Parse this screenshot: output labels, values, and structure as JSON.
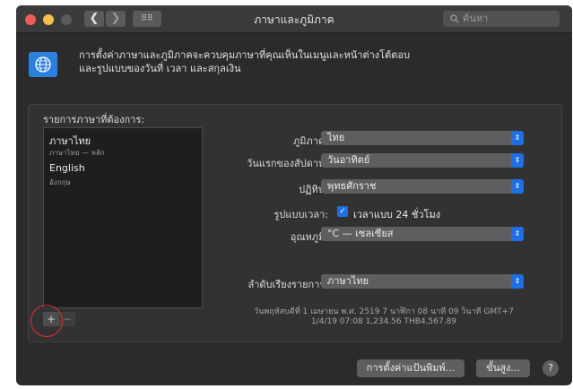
{
  "window": {
    "title": "ภาษาและภูมิภาค",
    "nav": {
      "back": "❮",
      "forward": "❯",
      "grid": "⠿⠿"
    },
    "search_placeholder": "ค้นหา",
    "traffic_lights": {
      "close": "#ec5f57",
      "minimize": "#f4bf4f",
      "zoom": "#5a5a5a"
    }
  },
  "header": {
    "icon": "globe-flag-icon",
    "line1": "การตั้งค่าภาษาและภูมิภาคจะควบคุมภาษาที่คุณเห็นในเมนูและหน้าต่างโต้ตอบ",
    "line2": "และรูปแบบของวันที่ เวลา และสกุลเงิน"
  },
  "preferred_languages": {
    "title": "รายการภาษาที่ต้องการ:",
    "items": [
      {
        "name": "ภาษาไทย",
        "sub": "ภาษาไทย — หลัก"
      },
      {
        "name": "English",
        "sub": "อังกฤษ"
      }
    ],
    "add_label": "+",
    "remove_label": "−"
  },
  "settings": {
    "region": {
      "label": "ภูมิภาค:",
      "value": "ไทย"
    },
    "first_day": {
      "label": "วันแรกของสัปดาห์:",
      "value": "วันอาทิตย์"
    },
    "calendar": {
      "label": "ปฏิทิน:",
      "value": "พุทธศักราช"
    },
    "time_format": {
      "label": "รูปแบบเวลา:",
      "checkbox_label": "เวลาแบบ 24 ชั่วโมง",
      "checked": true
    },
    "temperature": {
      "label": "อุณหภูมิ:",
      "value": "°C — เซลเซียส"
    },
    "list_sort": {
      "label": "ลำดับเรียงรายการ:",
      "value": "ภาษาไทย"
    }
  },
  "sample": {
    "line1": "วันพฤหัสบดีที่ 1 เมษายน พ.ศ. 2519 7 นาฬิกา 08 นาที 09 วินาที GMT+7",
    "line2": "1/4/19 07:08    1,234.56    THB4,567.89"
  },
  "footer": {
    "keyboard_button": "การตั้งค่าแป้นพิมพ์...",
    "advanced_button": "ขั้นสูง...",
    "help_label": "?"
  },
  "colors": {
    "accent": "#1f6fe0",
    "highlight_circle": "#e0322e"
  }
}
